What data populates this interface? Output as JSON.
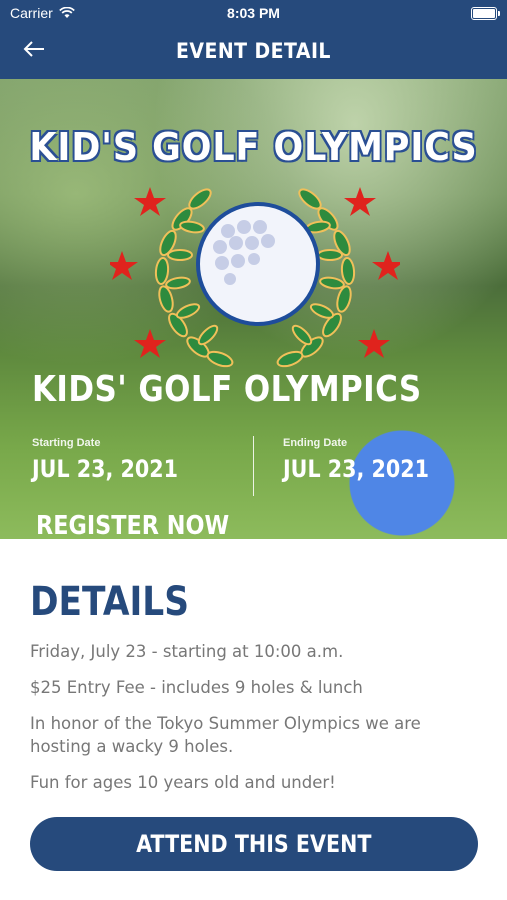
{
  "status_bar": {
    "carrier": "Carrier",
    "time": "8:03 PM"
  },
  "nav": {
    "title": "EVENT DETAIL",
    "back_icon": "arrow-left-icon"
  },
  "hero": {
    "script_title": "KID'S GOLF OLYMPICS",
    "event_title": "KIDS' GOLF OLYMPICS",
    "starting_label": "Starting Date",
    "starting_value": "JUL 23, 2021",
    "ending_label": "Ending Date",
    "ending_value": "JUL 23, 2021",
    "register_label": "REGISTER NOW"
  },
  "details": {
    "heading": "DETAILS",
    "lines": [
      "Friday, July 23 - starting at 10:00 a.m.",
      "$25 Entry Fee -  includes 9 holes & lunch",
      "In honor of the Tokyo Summer Olympics we are hosting a wacky 9 holes.",
      "Fun for ages 10 years old and under!"
    ],
    "attend_label": "ATTEND THIS EVENT"
  },
  "colors": {
    "brand": "#264a7c",
    "star": "#e0231d",
    "laurel": "#2e8b3e"
  }
}
